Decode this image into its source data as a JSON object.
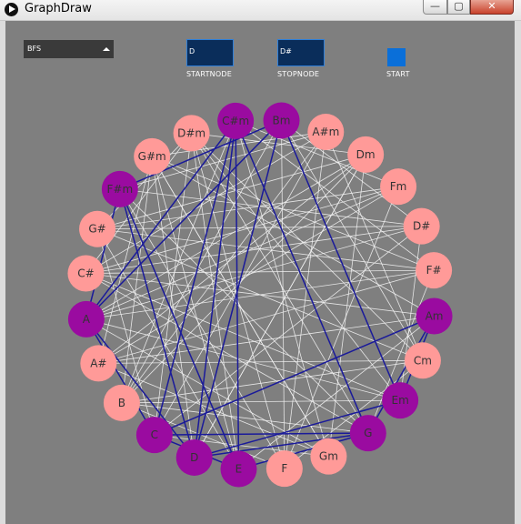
{
  "window": {
    "title": "GraphDraw",
    "min_glyph": "—",
    "max_glyph": "▢",
    "close_glyph": "✕"
  },
  "controls": {
    "algorithm": "BFS",
    "start_node_value": "D",
    "start_node_label": "STARTNODE",
    "stop_node_value": "D#",
    "stop_node_label": "STOPNODE",
    "start_label": "START"
  },
  "colors": {
    "background": "#7f7f7f",
    "node_default": "#ff9a98",
    "node_visited": "#9a0ba0",
    "edge_default": "#f2f2f2",
    "edge_path": "#1a1a9a",
    "field_bg": "#0a2d5a",
    "start_button": "#0a6fd9"
  },
  "graph": {
    "nodes": [
      {
        "label": "C#m",
        "visited": true
      },
      {
        "label": "Bm",
        "visited": true
      },
      {
        "label": "A#m",
        "visited": false
      },
      {
        "label": "Dm",
        "visited": false
      },
      {
        "label": "Fm",
        "visited": false
      },
      {
        "label": "D#",
        "visited": false
      },
      {
        "label": "F#",
        "visited": false
      },
      {
        "label": "Am",
        "visited": true
      },
      {
        "label": "Cm",
        "visited": false
      },
      {
        "label": "Em",
        "visited": true
      },
      {
        "label": "G",
        "visited": true
      },
      {
        "label": "Gm",
        "visited": false
      },
      {
        "label": "F",
        "visited": false
      },
      {
        "label": "E",
        "visited": true
      },
      {
        "label": "D",
        "visited": true
      },
      {
        "label": "C",
        "visited": true
      },
      {
        "label": "B",
        "visited": false
      },
      {
        "label": "A#",
        "visited": false
      },
      {
        "label": "A",
        "visited": true
      },
      {
        "label": "C#",
        "visited": false
      },
      {
        "label": "G#",
        "visited": false
      },
      {
        "label": "F#m",
        "visited": true
      },
      {
        "label": "G#m",
        "visited": false
      },
      {
        "label": "D#m",
        "visited": false
      }
    ],
    "path_edges": [
      [
        14,
        21
      ],
      [
        14,
        1
      ],
      [
        14,
        0
      ],
      [
        14,
        18
      ],
      [
        14,
        9
      ],
      [
        14,
        10
      ],
      [
        15,
        0
      ],
      [
        15,
        18
      ],
      [
        15,
        7
      ],
      [
        15,
        10
      ],
      [
        15,
        13
      ],
      [
        13,
        21
      ],
      [
        13,
        0
      ],
      [
        13,
        10
      ],
      [
        18,
        1
      ],
      [
        18,
        21
      ],
      [
        18,
        0
      ],
      [
        21,
        1
      ],
      [
        1,
        9
      ],
      [
        10,
        7
      ],
      [
        9,
        7
      ],
      [
        10,
        0
      ]
    ],
    "light_edges": [
      [
        0,
        6
      ],
      [
        0,
        4
      ],
      [
        0,
        11
      ],
      [
        0,
        16
      ],
      [
        1,
        8
      ],
      [
        1,
        12
      ],
      [
        1,
        16
      ],
      [
        1,
        5
      ],
      [
        2,
        8
      ],
      [
        2,
        16
      ],
      [
        2,
        19
      ],
      [
        2,
        12
      ],
      [
        3,
        17
      ],
      [
        3,
        18
      ],
      [
        3,
        11
      ],
      [
        3,
        14
      ],
      [
        4,
        20
      ],
      [
        4,
        17
      ],
      [
        4,
        12
      ],
      [
        4,
        18
      ],
      [
        5,
        20
      ],
      [
        5,
        19
      ],
      [
        5,
        15
      ],
      [
        5,
        9
      ],
      [
        6,
        19
      ],
      [
        6,
        20
      ],
      [
        6,
        22
      ],
      [
        6,
        10
      ],
      [
        7,
        17
      ],
      [
        7,
        19
      ],
      [
        7,
        22
      ],
      [
        7,
        13
      ],
      [
        8,
        17
      ],
      [
        8,
        16
      ],
      [
        8,
        23
      ],
      [
        8,
        12
      ],
      [
        9,
        23
      ],
      [
        9,
        16
      ],
      [
        9,
        19
      ],
      [
        9,
        18
      ],
      [
        10,
        16
      ],
      [
        10,
        21
      ],
      [
        10,
        19
      ],
      [
        10,
        23
      ],
      [
        11,
        17
      ],
      [
        11,
        22
      ],
      [
        11,
        15
      ],
      [
        11,
        18
      ],
      [
        12,
        16
      ],
      [
        12,
        23
      ],
      [
        12,
        21
      ],
      [
        13,
        20
      ],
      [
        13,
        23
      ],
      [
        13,
        22
      ],
      [
        14,
        22
      ],
      [
        14,
        3
      ],
      [
        15,
        20
      ],
      [
        15,
        2
      ],
      [
        15,
        23
      ],
      [
        16,
        22
      ],
      [
        16,
        3
      ],
      [
        17,
        22
      ],
      [
        17,
        6
      ],
      [
        18,
        5
      ],
      [
        18,
        6
      ],
      [
        19,
        23
      ],
      [
        19,
        4
      ],
      [
        20,
        3
      ],
      [
        20,
        8
      ],
      [
        21,
        2
      ],
      [
        21,
        5
      ],
      [
        22,
        2
      ],
      [
        22,
        11
      ],
      [
        23,
        3
      ],
      [
        23,
        20
      ]
    ]
  }
}
